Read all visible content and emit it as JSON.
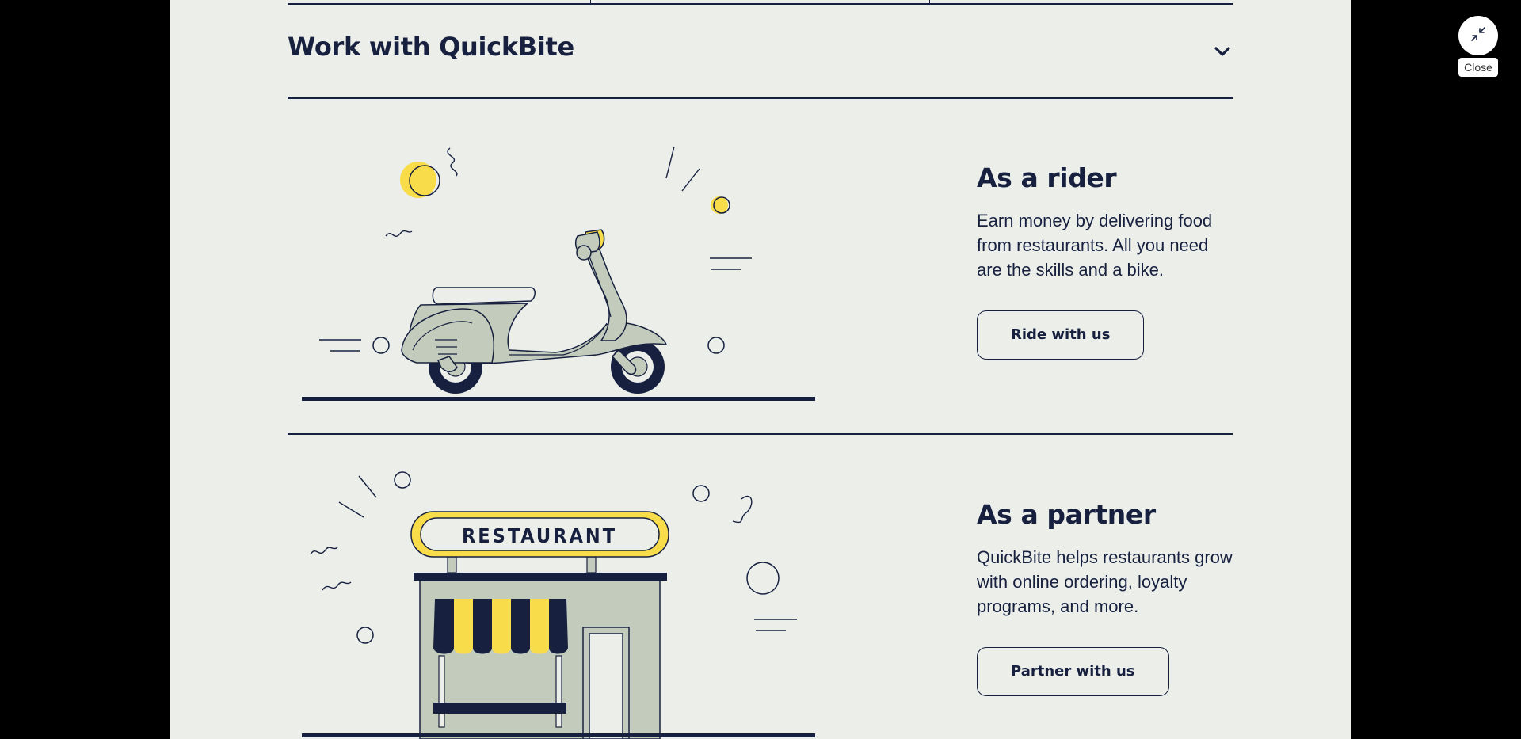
{
  "section": {
    "title": "Work with QuickBite",
    "toggle_icon": "chevron-down-icon"
  },
  "rider": {
    "illustration": "scooter-illustration",
    "heading": "As a rider",
    "description": "Earn money by delivering food from restaurants. All you need are the skills and a bike.",
    "button_label": "Ride with us"
  },
  "partner": {
    "illustration": "restaurant-illustration",
    "sign_text": "RESTAURANT",
    "heading": "As a partner",
    "description": "QuickBite helps restaurants grow with online ordering, loyalty programs, and more.",
    "button_label": "Partner with us"
  },
  "overlay": {
    "close_icon": "collapse-icon",
    "close_label": "Close"
  },
  "colors": {
    "background": "#000000",
    "panel": "#eceeea",
    "navy": "#17213f",
    "accent_yellow": "#f9dc4a",
    "sage": "#c3ccbc"
  }
}
